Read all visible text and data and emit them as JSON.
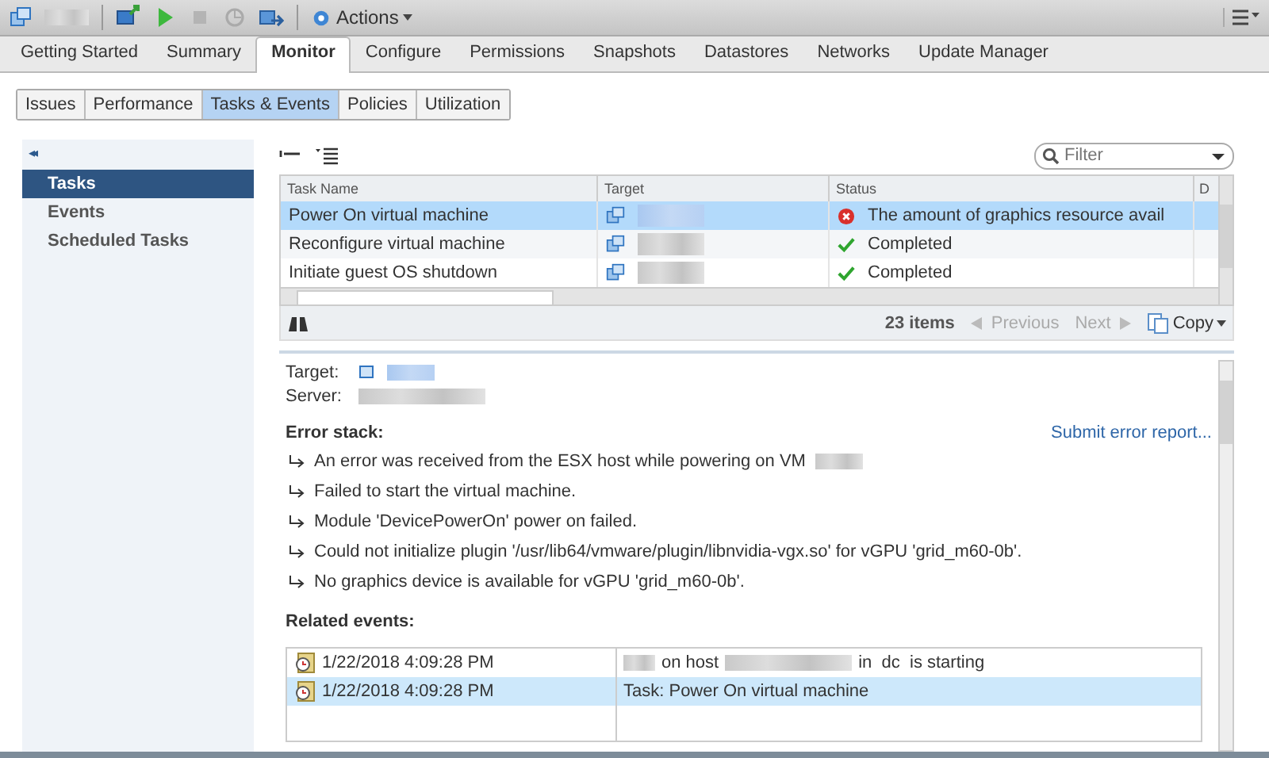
{
  "toolbar": {
    "actions_label": "Actions"
  },
  "tabs": [
    {
      "label": "Getting Started",
      "selected": false
    },
    {
      "label": "Summary",
      "selected": false
    },
    {
      "label": "Monitor",
      "selected": true
    },
    {
      "label": "Configure",
      "selected": false
    },
    {
      "label": "Permissions",
      "selected": false
    },
    {
      "label": "Snapshots",
      "selected": false
    },
    {
      "label": "Datastores",
      "selected": false
    },
    {
      "label": "Networks",
      "selected": false
    },
    {
      "label": "Update Manager",
      "selected": false
    }
  ],
  "subtabs": [
    {
      "label": "Issues",
      "selected": false
    },
    {
      "label": "Performance",
      "selected": false
    },
    {
      "label": "Tasks & Events",
      "selected": true
    },
    {
      "label": "Policies",
      "selected": false
    },
    {
      "label": "Utilization",
      "selected": false
    }
  ],
  "sidebar": {
    "collapse_glyph": "◂◂",
    "items": [
      {
        "label": "Tasks",
        "selected": true
      },
      {
        "label": "Events",
        "selected": false
      },
      {
        "label": "Scheduled Tasks",
        "selected": false
      }
    ]
  },
  "filter": {
    "placeholder": "Filter"
  },
  "table": {
    "columns": [
      "Task Name",
      "Target",
      "Status",
      "D"
    ],
    "rows": [
      {
        "task": "Power On virtual machine",
        "status": "The amount of graphics resource avail",
        "failed": true,
        "selected": true
      },
      {
        "task": "Reconfigure virtual machine",
        "status": "Completed",
        "failed": false,
        "selected": false
      },
      {
        "task": "Initiate guest OS shutdown",
        "status": "Completed",
        "failed": false,
        "selected": false
      }
    ]
  },
  "pager": {
    "count": "23 items",
    "previous": "Previous",
    "next": "Next",
    "copy": "Copy"
  },
  "details": {
    "target_label": "Target:",
    "server_label": "Server:",
    "error_heading": "Error stack:",
    "submit_link": "Submit error report...",
    "errors": [
      [
        {
          "kind": "text",
          "text": "An error was received from the ESX host while powering on VM"
        },
        {
          "kind": "redacted"
        }
      ],
      [
        {
          "kind": "text",
          "text": "Failed to start the virtual machine."
        }
      ],
      [
        {
          "kind": "text",
          "text": "Module 'DevicePowerOn' power on failed."
        }
      ],
      [
        {
          "kind": "text",
          "text": "Could not initialize plugin '/usr/lib64/vmware/plugin/libnvidia-vgx.so' for vGPU 'grid_m60-0b'."
        }
      ],
      [
        {
          "kind": "text",
          "text": "No graphics device is available for vGPU 'grid_m60-0b'."
        }
      ]
    ],
    "related_heading": "Related events:",
    "events": [
      {
        "time": "1/22/2018 4:09:28 PM",
        "selected": false,
        "parts": [
          {
            "kind": "redacted"
          },
          {
            "kind": "text",
            "text": "on host"
          },
          {
            "kind": "redacted"
          },
          {
            "kind": "text",
            "text": "in  dc  is starting"
          }
        ]
      },
      {
        "time": "1/22/2018 4:09:28 PM",
        "selected": true,
        "parts": [
          {
            "kind": "text",
            "text": "Task: Power On virtual machine"
          }
        ]
      }
    ]
  }
}
